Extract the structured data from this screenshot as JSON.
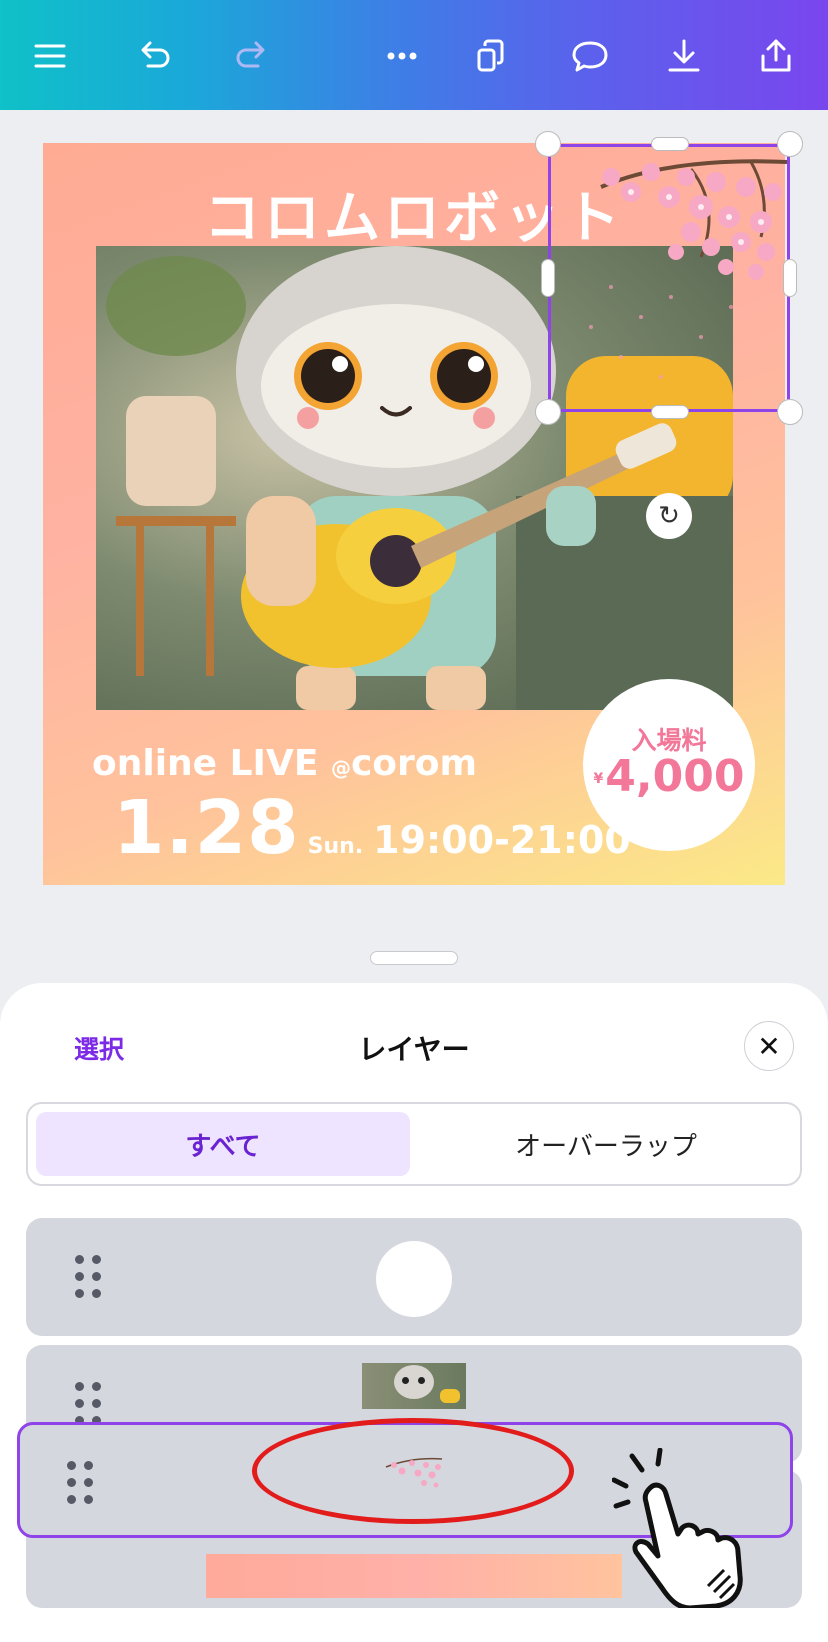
{
  "toolbar": {
    "icons": [
      "menu-icon",
      "undo-icon",
      "redo-icon",
      "more-icon",
      "duplicate-icon",
      "comment-icon",
      "download-icon",
      "share-icon"
    ]
  },
  "design": {
    "title": "コロムロボット",
    "event": "online LIVE",
    "at": "@",
    "venue": "corom",
    "date": "1.28",
    "day": "Sun.",
    "time": "19:00-21:00",
    "price_label": "入場料",
    "currency": "¥",
    "price": "4,000"
  },
  "sheet": {
    "select_label": "選択",
    "title": "レイヤー",
    "tabs": [
      {
        "label": "すべて",
        "selected": true
      },
      {
        "label": "オーバーラップ",
        "selected": false
      }
    ],
    "layers": [
      {
        "thumb": "white-circle"
      },
      {
        "thumb": "robot-photo"
      },
      {
        "thumb": "sakura-branch",
        "selected": true
      },
      {
        "thumb": "gradient-background"
      }
    ]
  },
  "colors": {
    "accent": "#7d2ae8",
    "selection": "#8e44e8",
    "annotation": "#e21b1b",
    "price_pink": "#f27799"
  }
}
